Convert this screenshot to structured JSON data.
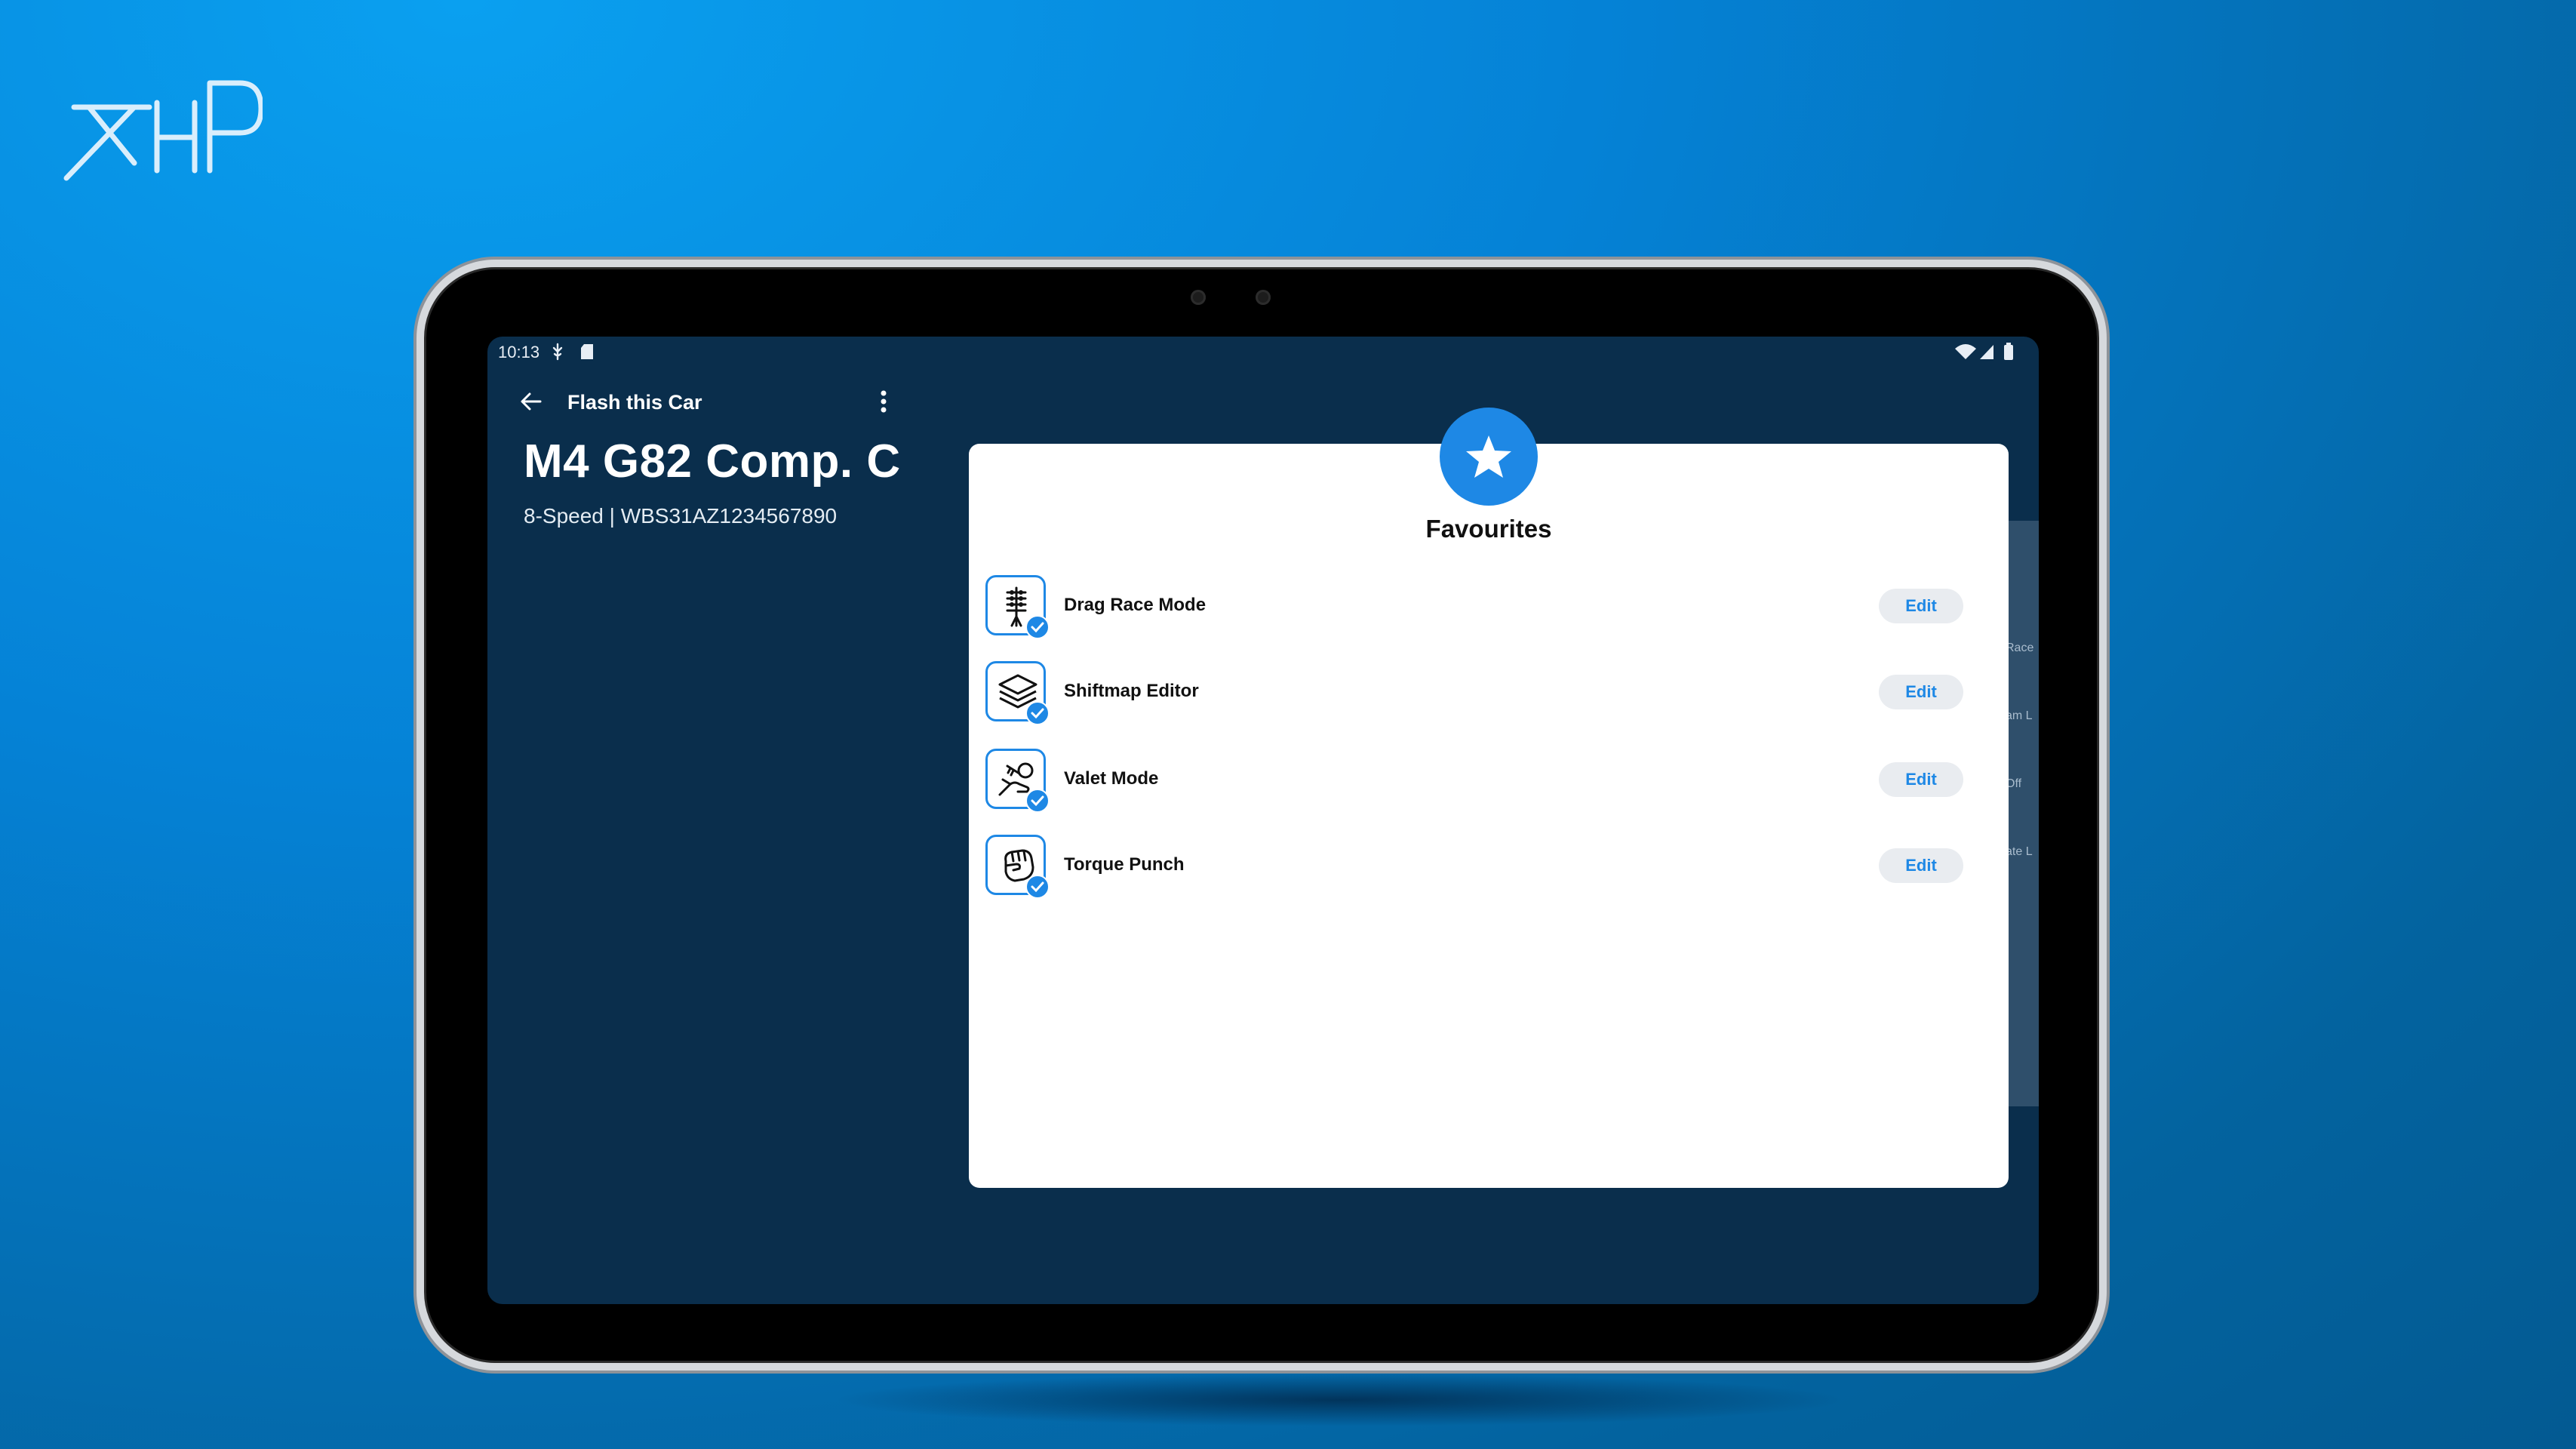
{
  "brand": {
    "logo_text": "XHP"
  },
  "status_bar": {
    "time": "10:13"
  },
  "app_bar": {
    "title": "Flash this Car"
  },
  "car": {
    "model": "M4 G82 Comp. C",
    "subtitle": "8-Speed | WBS31AZ1234567890"
  },
  "favourites": {
    "title": "Favourites",
    "items": [
      {
        "label": "Drag Race Mode",
        "icon": "drag-race-tree-icon",
        "edit_label": "Edit"
      },
      {
        "label": "Shiftmap Editor",
        "icon": "layers-icon",
        "edit_label": "Edit"
      },
      {
        "label": "Valet Mode",
        "icon": "key-hand-icon",
        "edit_label": "Edit"
      },
      {
        "label": "Torque Punch",
        "icon": "fist-icon",
        "edit_label": "Edit"
      }
    ]
  },
  "background_panel": {
    "fragments": [
      "Race",
      "am L",
      "Off",
      "ate L"
    ]
  },
  "colors": {
    "accent": "#1e88e5",
    "screen_bg": "#0a2e4c",
    "page_bg": "#0582d6"
  }
}
